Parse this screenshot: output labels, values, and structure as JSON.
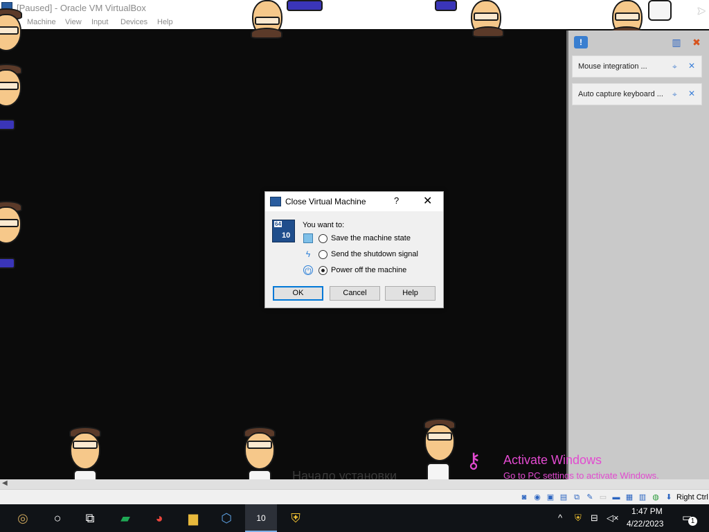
{
  "window": {
    "title": "[Paused] - Oracle VM VirtualBox",
    "menu": [
      "Machine",
      "View",
      "Input",
      "Devices",
      "Help"
    ]
  },
  "notifications": {
    "items": [
      {
        "text": "Mouse integration ..."
      },
      {
        "text": "Auto capture keyboard ..."
      }
    ]
  },
  "dialog": {
    "title": "Close Virtual Machine",
    "help_glyph": "?",
    "close_glyph": "✕",
    "os_badge": {
      "arch": "64",
      "version": "10"
    },
    "prompt": "You want to:",
    "options": [
      {
        "label": "Save the machine state",
        "icon": "save-state-icon",
        "selected": false
      },
      {
        "label": "Send the shutdown signal",
        "icon": "shutdown-signal-icon",
        "selected": false
      },
      {
        "label": "Power off the machine",
        "icon": "power-off-icon",
        "selected": true
      }
    ],
    "buttons": {
      "ok": "OK",
      "cancel": "Cancel",
      "help": "Help"
    }
  },
  "vm_background_text": "Начало установки",
  "statusbar": {
    "host_key": "Right Ctrl"
  },
  "watermark": {
    "title": "Activate Windows",
    "subtitle": "Go to PC settings to activate Windows."
  },
  "taskbar": {
    "active_item": "virtualbox-vm",
    "vm_badge": "10"
  },
  "clock": {
    "time": "1:47 PM",
    "date": "4/22/2023"
  },
  "notification_count": "1",
  "colors": {
    "accent": "#0078d7",
    "watermark": "#e24ad0",
    "vm_background": "#0b0b0b"
  }
}
